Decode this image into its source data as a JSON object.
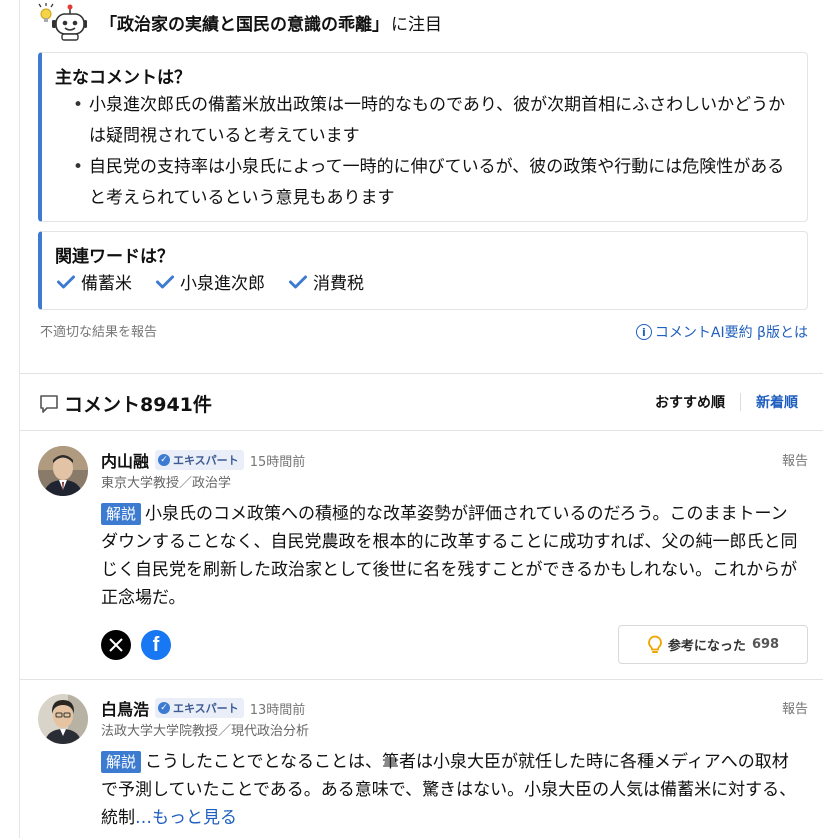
{
  "ai_summary": {
    "heading_quote": "「政治家の実績と国民の意識の乖離」",
    "heading_suffix": "に注目",
    "main_comments_title": "主なコメントは？",
    "main_comments": [
      "小泉進次郎氏の備蓄米放出政策は一時的なものであり、彼が次期首相にふさわしいかどうかは疑問視されていると考えています",
      "自民党の支持率は小泉氏によって一時的に伸びているが、彼の政策や行動には危険性があると考えられているという意見もあります"
    ],
    "related_words_title": "関連ワードは？",
    "related_words": [
      "備蓄米",
      "小泉進次郎",
      "消費税"
    ],
    "report_text": "不適切な結果を報告",
    "about_link": "コメントAI要約 β版とは"
  },
  "comments_section": {
    "title": "コメント8941件",
    "sort_options": [
      "おすすめ順",
      "新着順"
    ],
    "active_sort": "新着順"
  },
  "comments": [
    {
      "name": "内山融",
      "badge": "エキスパート",
      "time": "15時間前",
      "report": "報告",
      "affiliation": "東京大学教授／政治学",
      "tag": "解説",
      "text": "小泉氏のコメ政策への積極的な改革姿勢が評価されているのだろう。このままトーンダウンすることなく、自民党農政を根本的に改革することに成功すれば、父の純一郎氏と同じく自民党を刷新した政治家として後世に名を残すことができるかもしれない。これからが正念場だ。",
      "helpful_label": "参考になった",
      "helpful_count": "698"
    },
    {
      "name": "白鳥浩",
      "badge": "エキスパート",
      "time": "13時間前",
      "report": "報告",
      "affiliation": "法政大学大学院教授／現代政治分析",
      "tag": "解説",
      "text": "こうしたことでとなることは、筆者は小泉大臣が就任した時に各種メディアへの取材で予測していたことである。ある意味で、驚きはない。小泉大臣の人気は備蓄米に対する、統制",
      "more": "…もっと見る"
    }
  ],
  "colors": {
    "accent": "#3d7bd1",
    "link": "#1f5fbf",
    "facebook": "#1877f2"
  }
}
